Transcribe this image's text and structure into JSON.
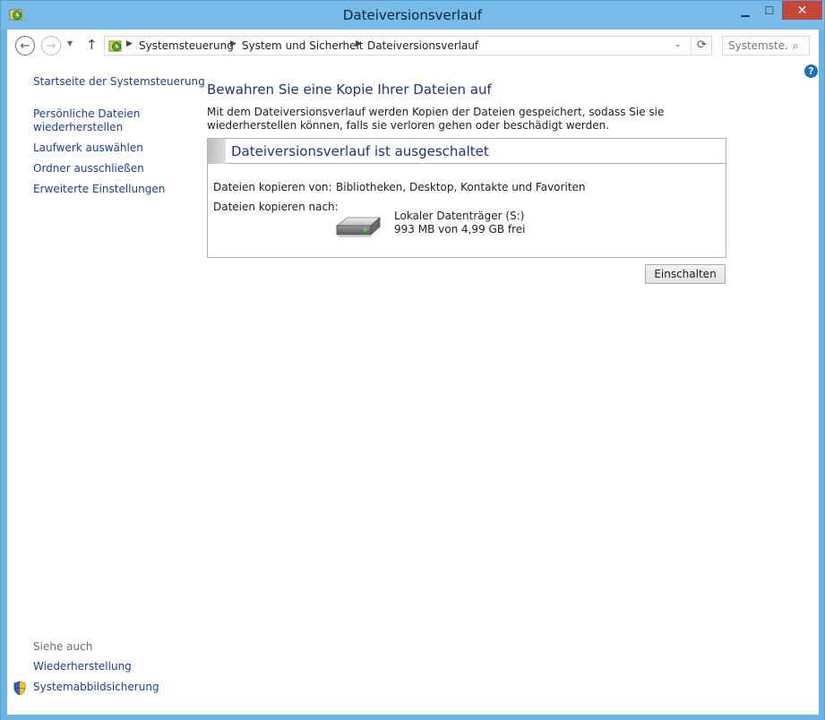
{
  "window": {
    "title": "Dateiversionsverlauf",
    "accent_color": "#76bbe9",
    "close_color": "#c7463b"
  },
  "titlebar_buttons": {
    "minimize": "▁",
    "maximize": "☐",
    "close": "✕"
  },
  "nav": {
    "back": "←",
    "forward": "→",
    "up": "↑",
    "dropdown": "▼",
    "refresh": "⟳"
  },
  "address": {
    "crumbs": [
      "Systemsteuerung",
      "System und Sicherheit",
      "Dateiversionsverlauf"
    ],
    "separator": "▶",
    "dropdown": "⌄"
  },
  "search": {
    "placeholder": "Systemste...",
    "icon": "⌕"
  },
  "help": {
    "label": "?"
  },
  "left_pane": {
    "links": [
      "Startseite der Systemsteuerung",
      "Persönliche Dateien wiederherstellen",
      "Laufwerk auswählen",
      "Ordner ausschließen",
      "Erweiterte Einstellungen"
    ],
    "see_also_heading": "Siehe auch",
    "see_also_links": [
      "Wiederherstellung",
      "Systemabbildsicherung"
    ]
  },
  "main": {
    "title": "Bewahren Sie eine Kopie Ihrer Dateien auf",
    "intro": "Mit dem Dateiversionsverlauf werden Kopien der Dateien gespeichert, sodass Sie sie wiederherstellen können, falls sie verloren gehen oder beschädigt werden.",
    "status_title": "Dateiversionsverlauf ist ausgeschaltet",
    "copy_from_label": "Dateien kopieren von:",
    "copy_from_value": "Bibliotheken, Desktop, Kontakte und Favoriten",
    "copy_to_label": "Dateien kopieren nach:",
    "drive_name": "Lokaler Datenträger (S:)",
    "drive_free": "993 MB von 4,99 GB frei",
    "turn_on_button": "Einschalten"
  }
}
